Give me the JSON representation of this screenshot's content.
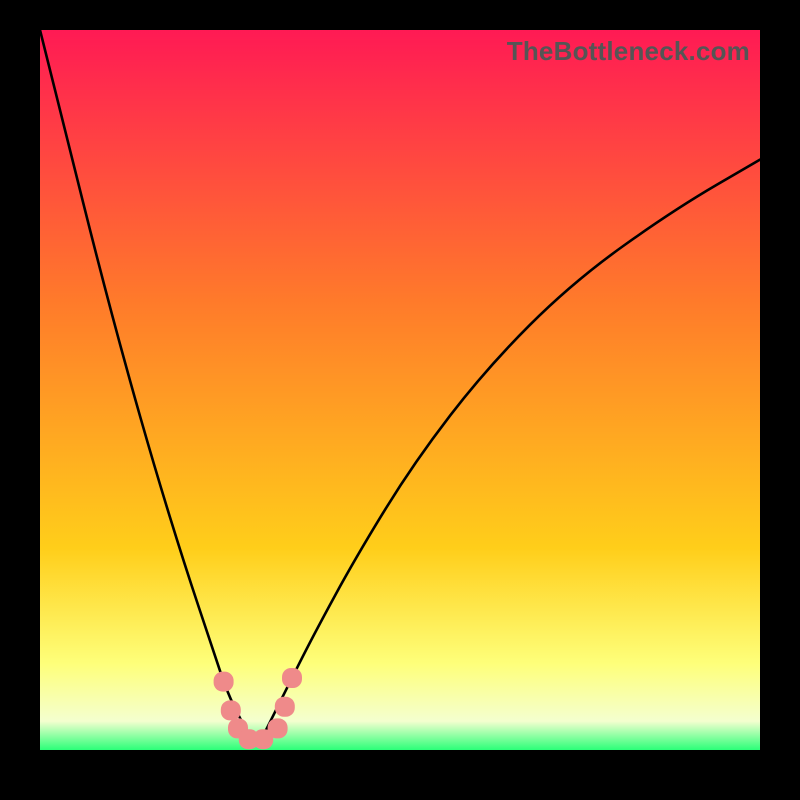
{
  "watermark": "TheBottleneck.com",
  "colors": {
    "top": "#ff1a54",
    "mid1": "#ff7b2a",
    "mid2": "#ffce1a",
    "yellowBand": "#feff7a",
    "paleBand": "#f4ffcf",
    "greenBand": "#2bff78",
    "curveStroke": "#000000",
    "markerFill": "#ef8a8a",
    "markerStroke": "#c05a5a"
  },
  "chart_data": {
    "type": "line",
    "title": "",
    "xlabel": "",
    "ylabel": "",
    "xlim": [
      0,
      100
    ],
    "ylim": [
      0,
      100
    ],
    "grid": false,
    "legend": false,
    "series": [
      {
        "name": "bottleneck-curve",
        "x": [
          0,
          4,
          8,
          12,
          16,
          20,
          24,
          26,
          28,
          29,
          30,
          31,
          32,
          34,
          38,
          44,
          52,
          62,
          74,
          88,
          100
        ],
        "y": [
          100,
          84,
          68,
          53,
          39,
          26,
          14,
          8,
          4,
          2,
          1,
          2,
          4,
          8,
          16,
          27,
          40,
          53,
          65,
          75,
          82
        ]
      }
    ],
    "markers": [
      {
        "x": 25.5,
        "y": 9.5
      },
      {
        "x": 26.5,
        "y": 5.5
      },
      {
        "x": 27.5,
        "y": 3.0
      },
      {
        "x": 29.0,
        "y": 1.5
      },
      {
        "x": 31.0,
        "y": 1.5
      },
      {
        "x": 33.0,
        "y": 3.0
      },
      {
        "x": 34.0,
        "y": 6.0
      },
      {
        "x": 35.0,
        "y": 10.0
      }
    ],
    "bands_y_from_bottom_pct": {
      "green_top": 2.5,
      "pale_top": 4.0,
      "yellow_top": 12.0
    }
  }
}
